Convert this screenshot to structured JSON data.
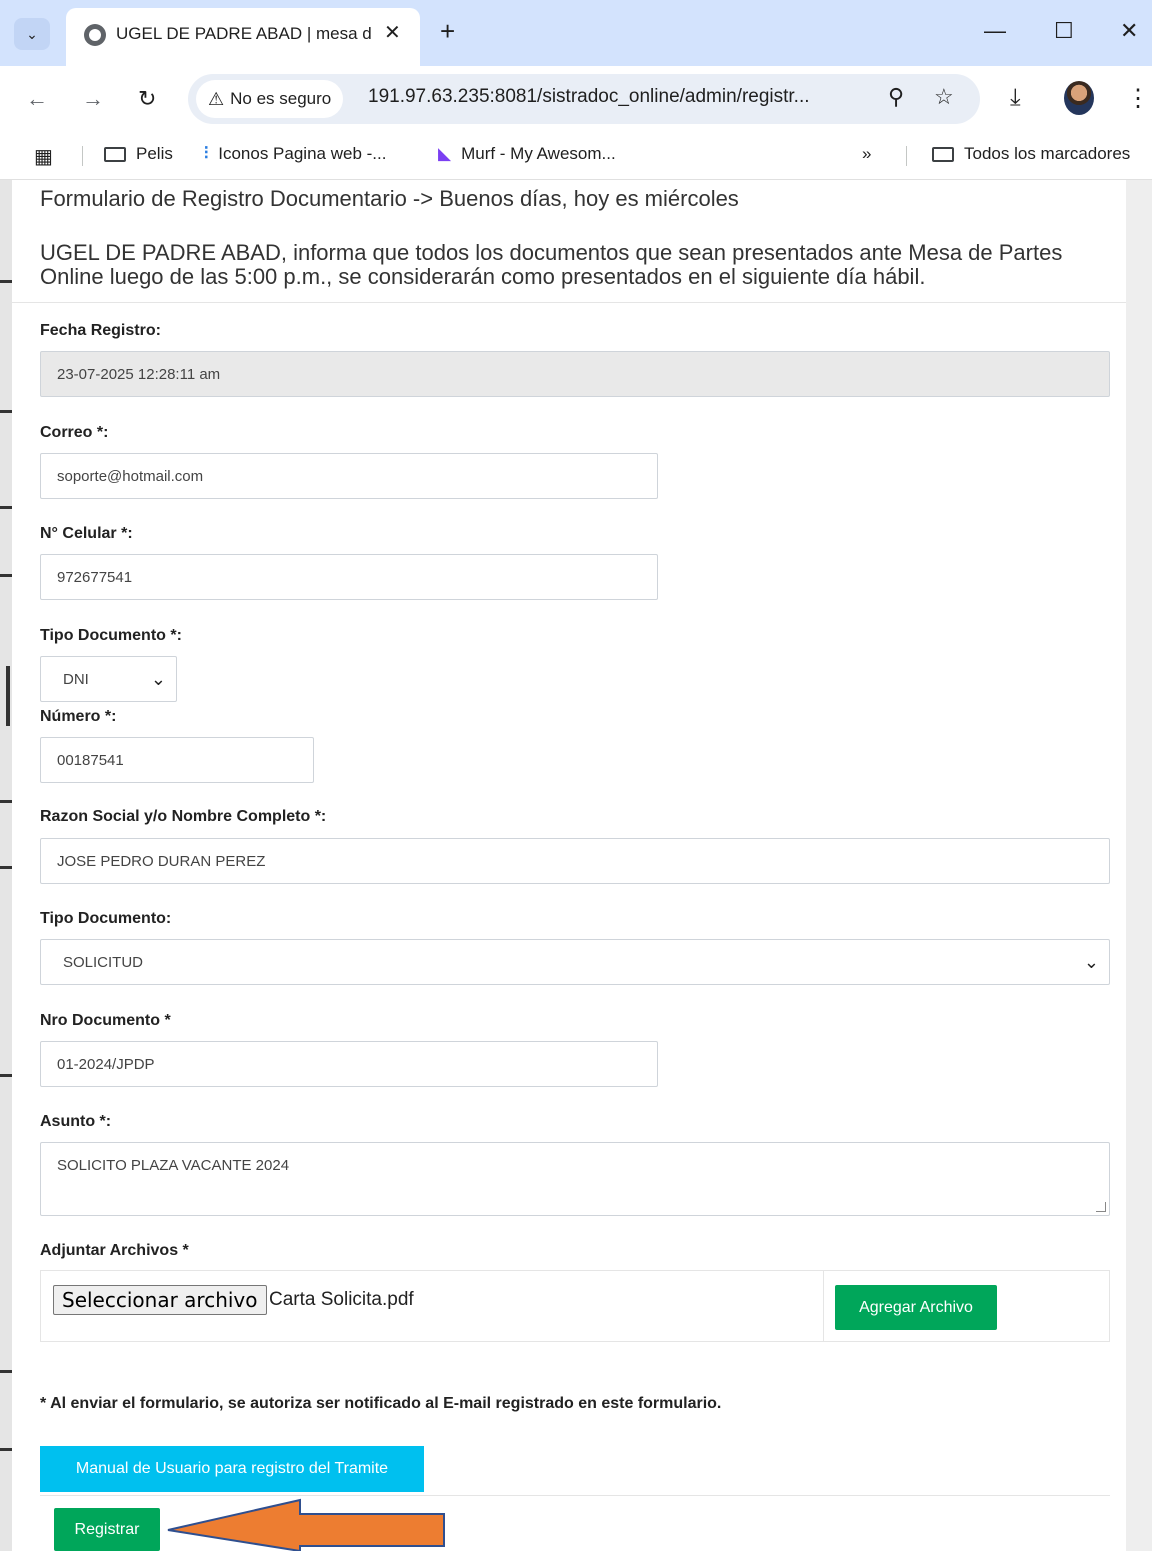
{
  "browser": {
    "tab_title": "UGEL DE PADRE ABAD | mesa d",
    "security_label": "No es seguro",
    "url": "191.97.63.235:8081/sistradoc_online/admin/registr...",
    "bookmarks": [
      "Pelis",
      "Iconos Pagina web -...",
      "Murf - My Awesom..."
    ],
    "overflow": "»",
    "all_bookmarks": "Todos los marcadores"
  },
  "page": {
    "header": "Formulario de Registro Documentario -> Buenos días, hoy es miércoles",
    "notice_line1": "UGEL DE PADRE ABAD, informa que todos los documentos que sean presentados ante Mesa de Partes",
    "notice_line2": "Online luego de las 5:00 p.m., se considerarán como presentados en el siguiente día hábil."
  },
  "form": {
    "fecha_label": "Fecha Registro:",
    "fecha_value": "23-07-2025 12:28:11 am",
    "correo_label": "Correo *:",
    "correo_value": "soporte@hotmail.com",
    "celular_label": "N° Celular *:",
    "celular_value": "972677541",
    "tipo_doc_id_label": "Tipo Documento *:",
    "tipo_doc_id_value": "DNI",
    "numero_label": "Número *:",
    "numero_value": "00187541",
    "razon_label": "Razon Social y/o Nombre Completo *:",
    "razon_value": "JOSE PEDRO DURAN PEREZ",
    "tipo_doc_label": "Tipo Documento:",
    "tipo_doc_value": "SOLICITUD",
    "nro_doc_label": "Nro Documento *",
    "nro_doc_value": "01-2024/JPDP",
    "asunto_label": "Asunto *:",
    "asunto_value": "SOLICITO PLAZA VACANTE 2024",
    "adjuntar_label": "Adjuntar Archivos *",
    "file_button": "Seleccionar archivo",
    "file_name": "Carta Solicita.pdf",
    "add_file_button": "Agregar Archivo",
    "note": "* Al enviar el formulario, se autoriza ser notificado al E-mail registrado en este formulario.",
    "manual_button": "Manual de Usuario para registro del Tramite",
    "submit_button": "Registrar"
  },
  "colors": {
    "green": "#00a65a",
    "cyan": "#00c0ef",
    "arrow": "#ed7d31"
  }
}
